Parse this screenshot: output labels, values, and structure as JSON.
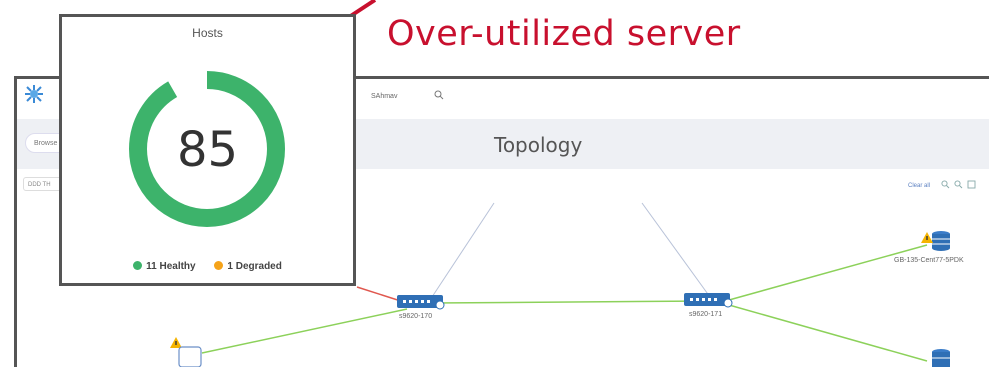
{
  "annotation": {
    "text": "Over-utilized server"
  },
  "app": {
    "username": "SAhmav",
    "browse_label": "Browse",
    "page_title": "Topology",
    "tag_chip": "DDD TH",
    "clear_all": "Clear all"
  },
  "topology": {
    "switches": [
      {
        "label": "s9620-170"
      },
      {
        "label": "s9620-171"
      }
    ],
    "hosts": [
      {
        "label": "GB-135-Cent77-5PDK",
        "warning": true
      }
    ]
  },
  "hosts_card": {
    "title": "Hosts",
    "score": "85",
    "healthy_count": 11,
    "degraded_count": 1,
    "legend": {
      "healthy": "11 Healthy",
      "degraded": "1 Degraded"
    }
  },
  "colors": {
    "healthy": "#3db36b",
    "degraded": "#f5a31a",
    "annotation": "#c8102e",
    "link_ok": "#8cd15a",
    "link_bad": "#e0584f",
    "switch": "#2f6fb5"
  }
}
